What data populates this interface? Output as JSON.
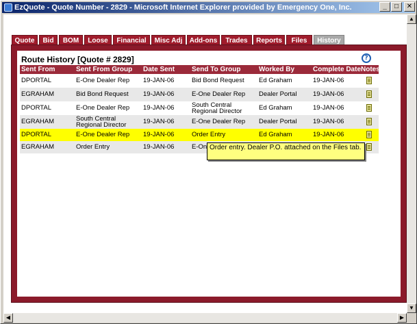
{
  "window": {
    "title": "EzQuote - Quote Number - 2829 - Microsoft Internet Explorer provided by Emergency One, Inc.",
    "minimize_label": "_",
    "maximize_label": "□",
    "close_label": "✕"
  },
  "tabs": [
    {
      "label": "Quote"
    },
    {
      "label": "Bid"
    },
    {
      "label": "BOM"
    },
    {
      "label": "Loose"
    },
    {
      "label": "Financial"
    },
    {
      "label": "Misc Adj"
    },
    {
      "label": "Add-ons"
    },
    {
      "label": "Trades"
    },
    {
      "label": "Reports"
    },
    {
      "label": "Files"
    },
    {
      "label": "History",
      "active": true
    }
  ],
  "route_history": {
    "title": "Route History [Quote # 2829]",
    "help_icon": "help-icon",
    "columns": [
      "Sent From",
      "Sent From Group",
      "Date Sent",
      "Send To Group",
      "Worked By",
      "Complete Date",
      "Notes"
    ],
    "rows": [
      {
        "sent_from": "DPORTAL",
        "sent_from_group": "E-One Dealer Rep",
        "date_sent": "19-JAN-06",
        "send_to_group": "Bid Bond Request",
        "worked_by": "Ed Graham",
        "complete_date": "19-JAN-06",
        "notes_icon": "note-icon"
      },
      {
        "sent_from": "EGRAHAM",
        "sent_from_group": "Bid Bond Request",
        "date_sent": "19-JAN-06",
        "send_to_group": "E-One Dealer Rep",
        "worked_by": "Dealer Portal",
        "complete_date": "19-JAN-06",
        "notes_icon": "note-icon"
      },
      {
        "sent_from": "DPORTAL",
        "sent_from_group": "E-One Dealer Rep",
        "date_sent": "19-JAN-06",
        "send_to_group": "South Central Regional Director",
        "worked_by": "Ed Graham",
        "complete_date": "19-JAN-06",
        "notes_icon": "note-icon"
      },
      {
        "sent_from": "EGRAHAM",
        "sent_from_group": "South Central Regional Director",
        "date_sent": "19-JAN-06",
        "send_to_group": "E-One Dealer Rep",
        "worked_by": "Dealer Portal",
        "complete_date": "19-JAN-06",
        "notes_icon": "note-icon"
      },
      {
        "sent_from": "DPORTAL",
        "sent_from_group": "E-One Dealer Rep",
        "date_sent": "19-JAN-06",
        "send_to_group": "Order Entry",
        "worked_by": "Ed Graham",
        "complete_date": "19-JAN-06",
        "notes_icon": "note-icon",
        "highlighted": true
      },
      {
        "sent_from": "EGRAHAM",
        "sent_from_group": "Order Entry",
        "date_sent": "19-JAN-06",
        "send_to_group": "E-One",
        "worked_by": "",
        "complete_date": "",
        "notes_icon": "note-icon"
      }
    ]
  },
  "tooltip": {
    "text": "Order entry. Dealer P.O. attached on the Files tab."
  },
  "colors": {
    "tab_bg": "#a01c2c",
    "frame_bg": "#8b1a2a",
    "header_bg": "#9b2a3a",
    "highlight_row": "#ffff00",
    "tooltip_bg": "#ffff80"
  }
}
